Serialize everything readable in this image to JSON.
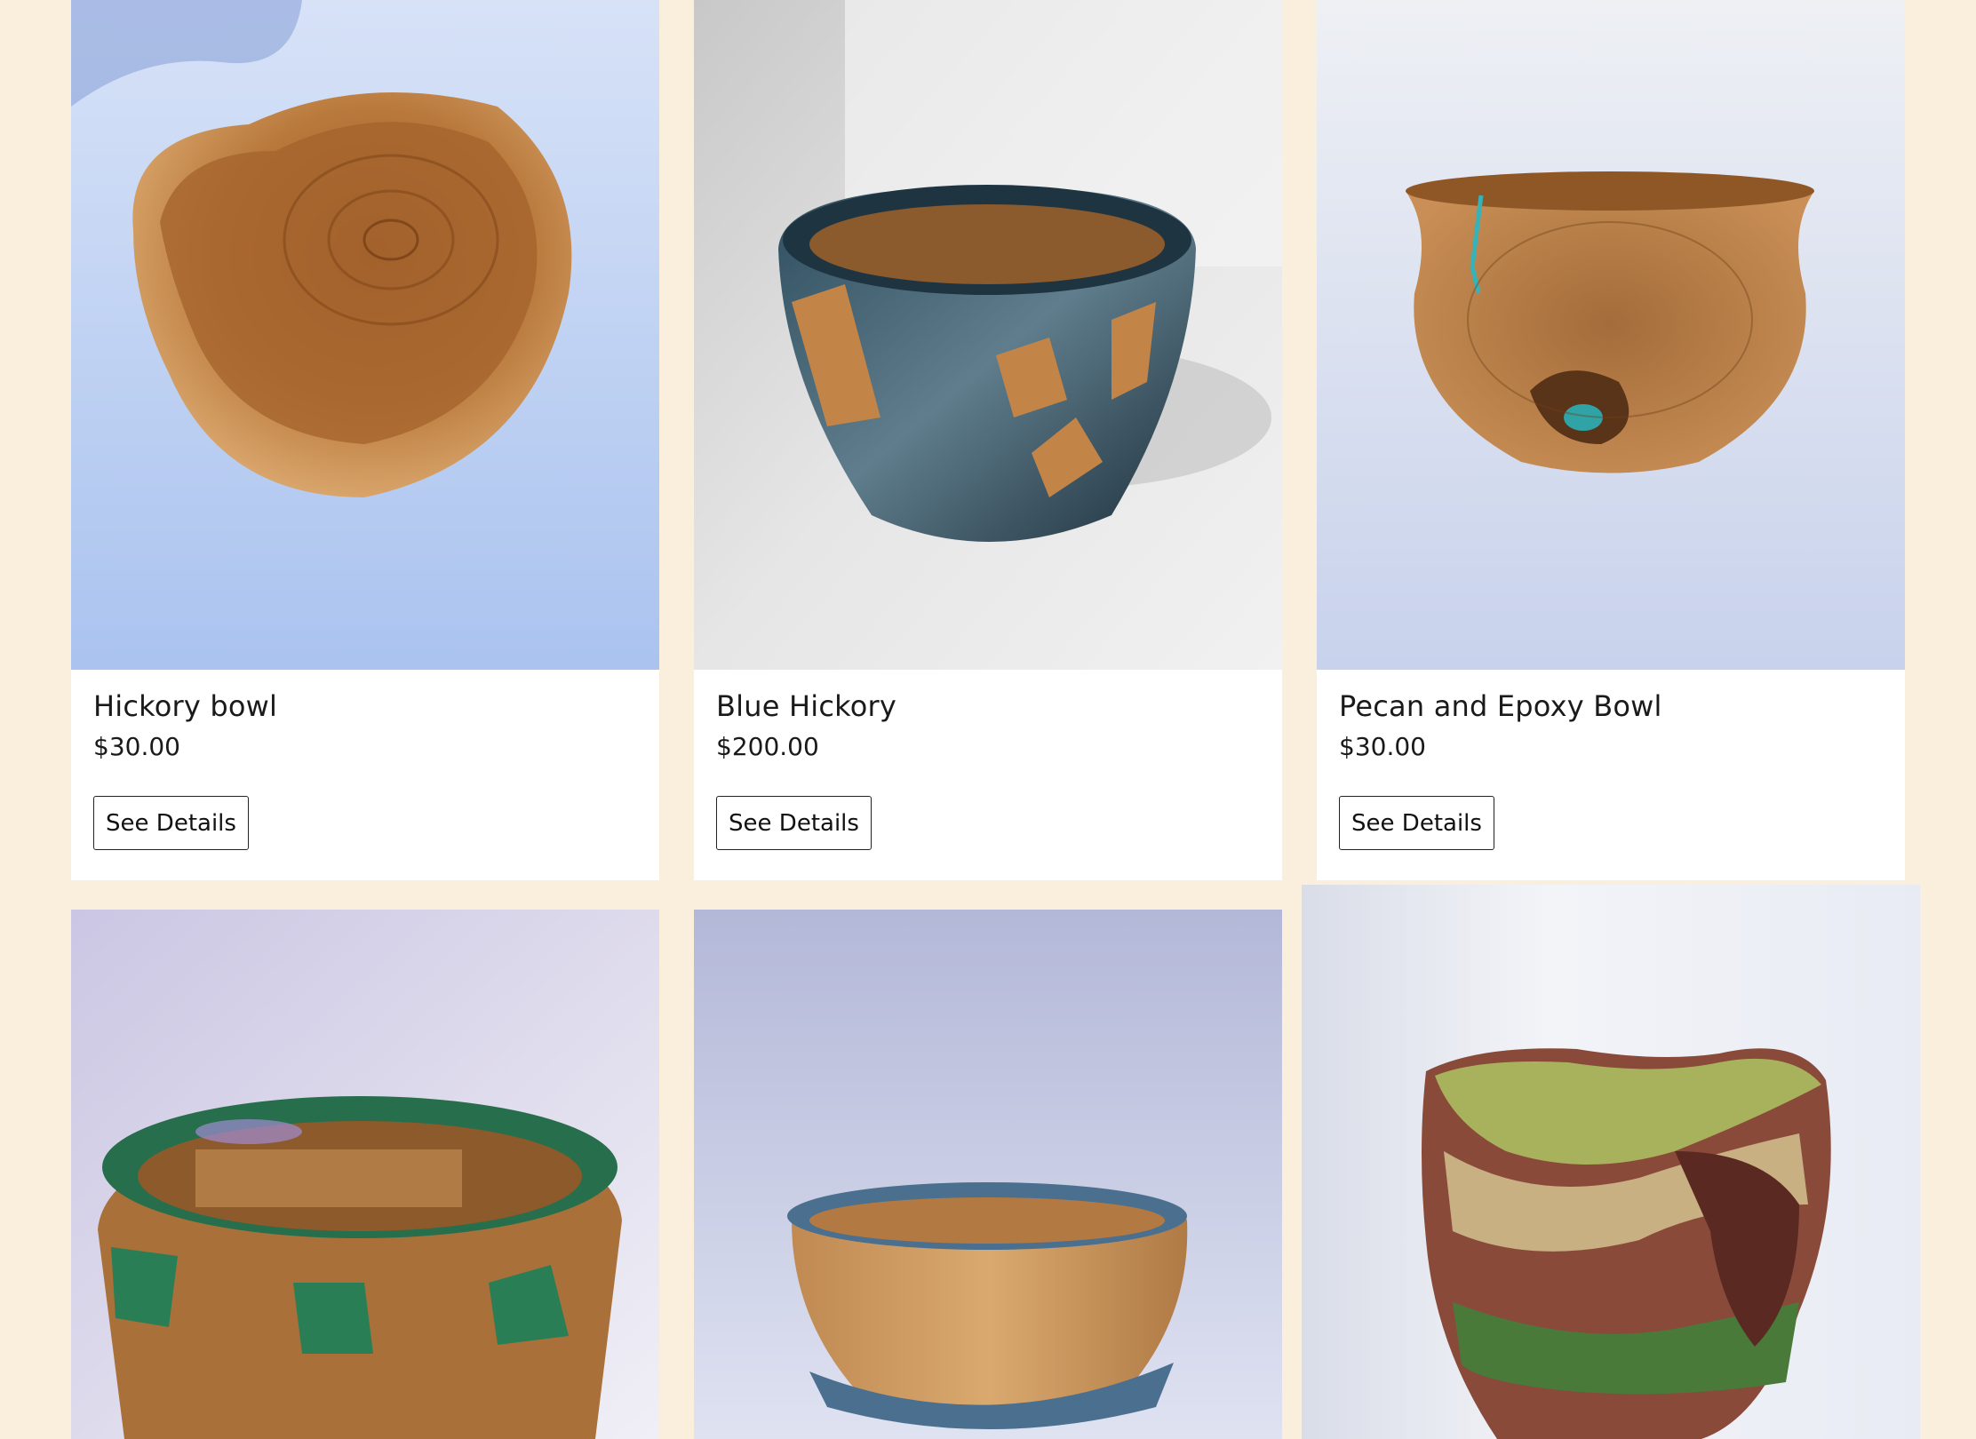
{
  "products": [
    {
      "title": "Hickory bowl",
      "price": "$30.00",
      "button_label": "See Details"
    },
    {
      "title": "Blue Hickory",
      "price": "$200.00",
      "button_label": "See Details"
    },
    {
      "title": "Pecan and Epoxy Bowl",
      "price": "$30.00",
      "button_label": "See Details"
    },
    {
      "title": "",
      "price": "",
      "button_label": ""
    },
    {
      "title": "",
      "price": "",
      "button_label": ""
    },
    {
      "title": "",
      "price": "",
      "button_label": ""
    }
  ],
  "colors": {
    "page_background": "#faeedc",
    "card_background": "#ffffff",
    "text": "#1a1a1a"
  }
}
